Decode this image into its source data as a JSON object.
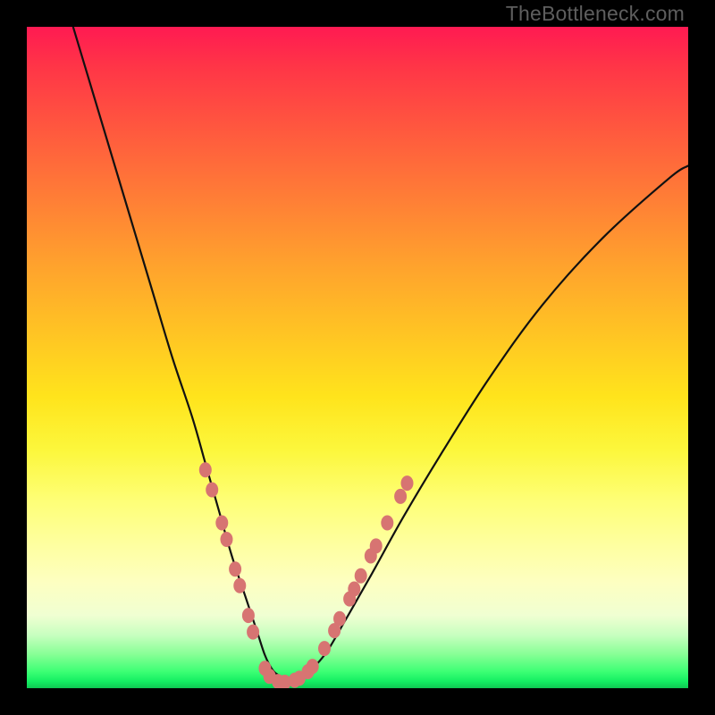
{
  "watermark": "TheBottleneck.com",
  "chart_data": {
    "type": "line",
    "title": "",
    "xlabel": "",
    "ylabel": "",
    "xlim": [
      0,
      100
    ],
    "ylim": [
      0,
      100
    ],
    "grid": false,
    "legend": false,
    "series": [
      {
        "name": "bottleneck-curve",
        "x": [
          7,
          10,
          13,
          16,
          19,
          22,
          25,
          27,
          29,
          31,
          33,
          34,
          35,
          36,
          37,
          38,
          40,
          42,
          45,
          48,
          52,
          57,
          63,
          70,
          78,
          87,
          97,
          100
        ],
        "y": [
          100,
          90,
          80,
          70,
          60,
          50,
          41,
          34,
          27,
          20,
          14,
          11,
          8,
          5,
          3,
          2,
          1,
          2,
          5,
          10,
          17,
          26,
          36,
          47,
          58,
          68,
          77,
          79
        ]
      }
    ],
    "markers": {
      "name": "highlight-beads",
      "points": [
        {
          "x": 27.0,
          "y": 33.0
        },
        {
          "x": 28.0,
          "y": 30.0
        },
        {
          "x": 29.5,
          "y": 25.0
        },
        {
          "x": 30.2,
          "y": 22.5
        },
        {
          "x": 31.5,
          "y": 18.0
        },
        {
          "x": 32.2,
          "y": 15.5
        },
        {
          "x": 33.5,
          "y": 11.0
        },
        {
          "x": 34.2,
          "y": 8.5
        },
        {
          "x": 36.0,
          "y": 3.0
        },
        {
          "x": 36.7,
          "y": 1.8
        },
        {
          "x": 38.0,
          "y": 1.0
        },
        {
          "x": 39.0,
          "y": 0.9
        },
        {
          "x": 40.5,
          "y": 1.2
        },
        {
          "x": 41.2,
          "y": 1.5
        },
        {
          "x": 42.5,
          "y": 2.5
        },
        {
          "x": 43.2,
          "y": 3.3
        },
        {
          "x": 45.0,
          "y": 6.0
        },
        {
          "x": 46.5,
          "y": 8.7
        },
        {
          "x": 47.3,
          "y": 10.5
        },
        {
          "x": 48.8,
          "y": 13.5
        },
        {
          "x": 49.5,
          "y": 15.0
        },
        {
          "x": 50.5,
          "y": 17.0
        },
        {
          "x": 52.0,
          "y": 20.0
        },
        {
          "x": 52.8,
          "y": 21.5
        },
        {
          "x": 54.5,
          "y": 25.0
        },
        {
          "x": 56.5,
          "y": 29.0
        },
        {
          "x": 57.5,
          "y": 31.0
        }
      ]
    }
  },
  "colors": {
    "bead": "#d77472",
    "curve": "#111111",
    "frame": "#000000"
  }
}
